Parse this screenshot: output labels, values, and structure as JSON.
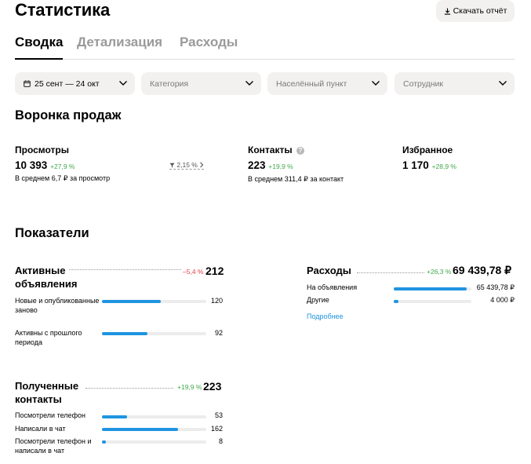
{
  "header": {
    "title": "Статистика",
    "download_label": "Скачать отчёт"
  },
  "tabs": [
    {
      "label": "Сводка",
      "active": true
    },
    {
      "label": "Детализация",
      "active": false
    },
    {
      "label": "Расходы",
      "active": false
    }
  ],
  "filters": {
    "period": "25 сент — 24 окт",
    "category_placeholder": "Категория",
    "locality_placeholder": "Населённый пункт",
    "employee_placeholder": "Сотрудник"
  },
  "funnel": {
    "title": "Воронка продаж",
    "views": {
      "label": "Просмотры",
      "value": "10 393",
      "delta": "+27,9 %",
      "sub": "В среднем 6,7 ₽ за просмотр"
    },
    "conversion": "2,15 %",
    "contacts": {
      "label": "Контакты",
      "value": "223",
      "delta": "+19,9 %",
      "sub": "В среднем 311,4 ₽ за контакт"
    },
    "favorites": {
      "label": "Избранное",
      "value": "1 170",
      "delta": "+28,9 %"
    }
  },
  "indicators": {
    "title": "Показатели",
    "active_ads": {
      "title": "Активные объявления",
      "delta": "–5,4 %",
      "total": "212",
      "rows": [
        {
          "label": "Новые и опубликованные заново",
          "value": "120",
          "fraction": 0.566
        },
        {
          "label": "Активны с прошлого периода",
          "value": "92",
          "fraction": 0.434
        }
      ]
    },
    "expenses": {
      "title": "Расходы",
      "delta": "+26,3 %",
      "total": "69 439,78 ₽",
      "rows": [
        {
          "label": "На объявления",
          "value": "65 439,78 ₽",
          "fraction": 0.942
        },
        {
          "label": "Другие",
          "value": "4 000 ₽",
          "fraction": 0.058
        }
      ],
      "link": "Подробнее"
    },
    "contacts": {
      "title": "Полученные контакты",
      "delta": "+19,9 %",
      "total": "223",
      "rows": [
        {
          "label": "Посмотрели телефон",
          "value": "53",
          "fraction": 0.238
        },
        {
          "label": "Написали в чат",
          "value": "162",
          "fraction": 0.726
        },
        {
          "label": "Посмотрели телефон и написали в чат",
          "value": "8",
          "fraction": 0.036
        }
      ]
    }
  },
  "colors": {
    "accent": "#1f94e0",
    "positive": "#3fa94a",
    "negative": "#e5404a",
    "chip_bg": "#f2f1f0"
  },
  "icons": [
    "download-icon",
    "calendar-icon",
    "chevron-down-icon",
    "help-icon",
    "filter-funnel-icon",
    "chevron-right-icon"
  ]
}
